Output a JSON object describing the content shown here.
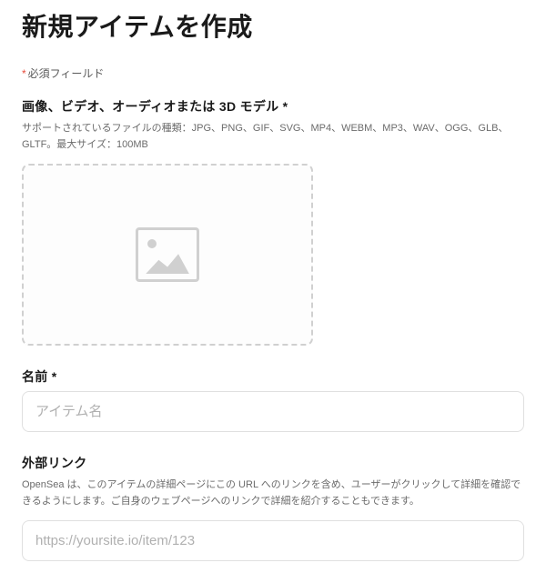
{
  "page_title": "新規アイテムを作成",
  "required_note": "必須フィールド",
  "upload": {
    "label": "画像、ビデオ、オーディオまたは 3D モデル *",
    "help": "サポートされているファイルの種類：JPG、PNG、GIF、SVG、MP4、WEBM、MP3、WAV、OGG、GLB、GLTF。最大サイズ：100MB"
  },
  "name_field": {
    "label": "名前 *",
    "placeholder": "アイテム名"
  },
  "external_link": {
    "label": "外部リンク",
    "help": "OpenSea は、このアイテムの詳細ページにこの URL へのリンクを含め、ユーザーがクリックして詳細を確認できるようにします。ご自身のウェブページへのリンクで詳細を紹介することもできます。",
    "placeholder": "https://yoursite.io/item/123"
  }
}
